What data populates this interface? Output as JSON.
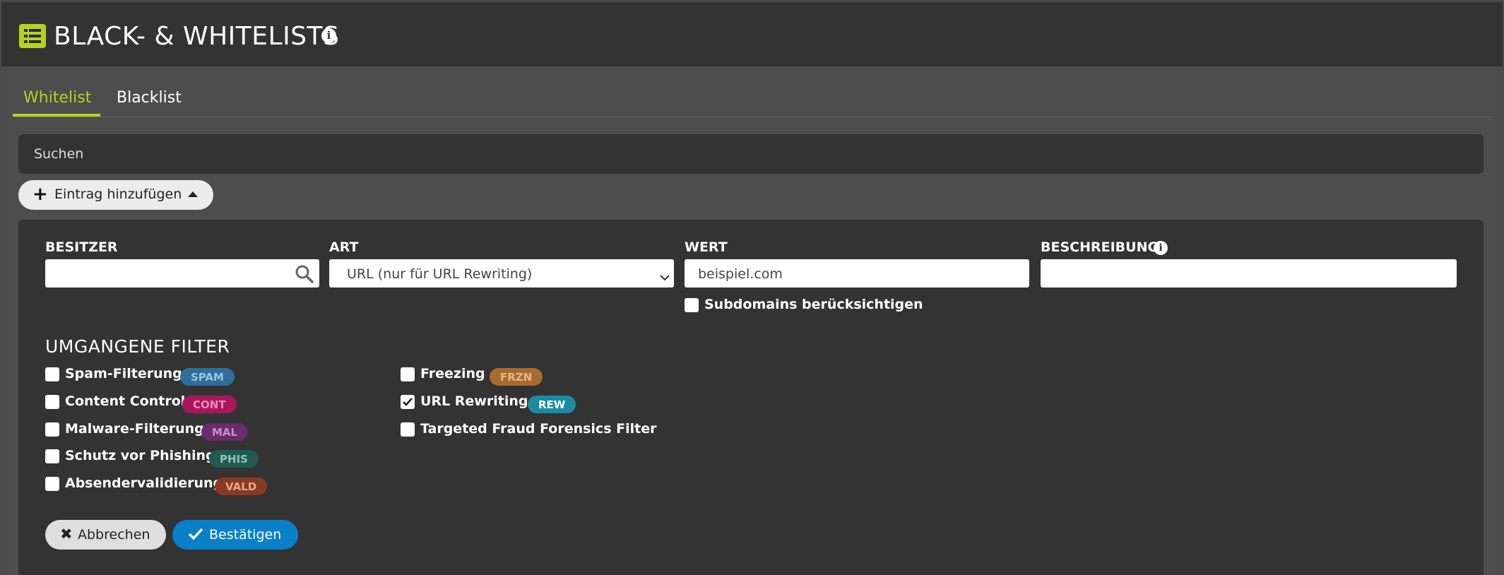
{
  "header": {
    "title": "BLACK- & WHITELISTS",
    "list_icon": "list-icon",
    "info_icon": "info-icon",
    "info_glyph": "i",
    "accent_color": "#b6d21f"
  },
  "tabs": [
    {
      "label": "Whitelist",
      "active": true
    },
    {
      "label": "Blacklist",
      "active": false
    }
  ],
  "search": {
    "placeholder": "Suchen"
  },
  "add_entry": {
    "label": "Eintrag hinzufügen",
    "plus_glyph": "+"
  },
  "form": {
    "owner": {
      "label": "BESITZER",
      "value": ""
    },
    "type": {
      "label": "ART",
      "selected": "URL (nur für URL Rewriting)"
    },
    "value": {
      "label": "WERT",
      "value": "beispiel.com"
    },
    "description": {
      "label": "BESCHREIBUNG",
      "value": "",
      "info_glyph": "i"
    },
    "subdomains": {
      "label": "Subdomains berücksichtigen",
      "checked": false
    }
  },
  "filters": {
    "title": "UMGANGENE FILTER",
    "left": [
      {
        "label": "Spam-Filterung",
        "badge": "SPAM",
        "color": "#2f6e9a",
        "text_color": "#9cc3de",
        "checked": false
      },
      {
        "label": "Content Control",
        "badge": "CONT",
        "color": "#a8175c",
        "text_color": "#f08ab8",
        "checked": false
      },
      {
        "label": "Malware-Filterung",
        "badge": "MAL",
        "color": "#6b2c6e",
        "text_color": "#c590c8",
        "checked": false
      },
      {
        "label": "Schutz vor Phishing",
        "badge": "PHIS",
        "color": "#235a50",
        "text_color": "#8fc3b8",
        "checked": false
      },
      {
        "label": "Absendervalidierung",
        "badge": "VALD",
        "color": "#8a3a22",
        "text_color": "#e6a58c",
        "checked": false
      }
    ],
    "right": [
      {
        "label": "Freezing",
        "badge": "FRZN",
        "color": "#a86b2f",
        "text_color": "#e3b98c",
        "checked": false
      },
      {
        "label": "URL Rewriting",
        "badge": "REW",
        "color": "#1c8aa3",
        "text_color": "#ffffff",
        "checked": true
      },
      {
        "label": "Targeted Fraud Forensics Filter",
        "badge": "",
        "checked": false
      }
    ]
  },
  "actions": {
    "cancel": {
      "label": "Abbrechen",
      "x_glyph": "✖"
    },
    "confirm": {
      "label": "Bestätigen",
      "color": "#0a80c8"
    }
  }
}
